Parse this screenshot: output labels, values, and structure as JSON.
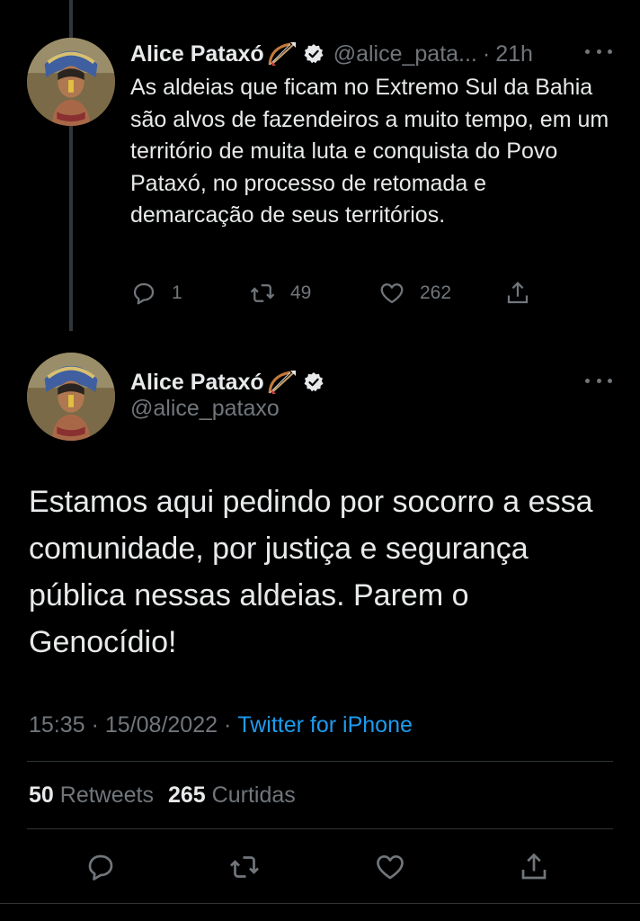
{
  "tweet1": {
    "author_name": "Alice Pataxó",
    "author_handle": "@alice_pata...",
    "time_separator": "·",
    "time": "21h",
    "text": "As aldeias que ficam no Extremo Sul da Bahia são alvos de fazendeiros a muito tempo, em um território de muita luta e conquista do Povo Pataxó, no processo de retomada e demarcação de seus territórios.",
    "reply_count": "1",
    "retweet_count": "49",
    "like_count": "262"
  },
  "tweet2": {
    "author_name": "Alice Pataxó",
    "author_handle": "@alice_pataxo",
    "text": "Estamos aqui pedindo por socorro a essa comunidade, por justiça e segurança pública nessas aldeias. Parem o Genocídio!",
    "time": "15:35",
    "separator": "·",
    "date": "15/08/2022",
    "source": "Twitter for iPhone",
    "retweets_count": "50",
    "retweets_label": "Retweets",
    "likes_count": "265",
    "likes_label": "Curtidas"
  },
  "icons": {
    "reply": "reply-icon",
    "retweet": "retweet-icon",
    "like": "heart-icon",
    "share": "share-icon",
    "verified": "verified-badge-icon",
    "emoji": "bow-and-arrow-emoji",
    "more": "more-options-icon"
  },
  "colors": {
    "background": "#000000",
    "text": "#e7e9ea",
    "secondary": "#71767b",
    "link": "#1d9bf0",
    "divider": "#2f3336"
  }
}
